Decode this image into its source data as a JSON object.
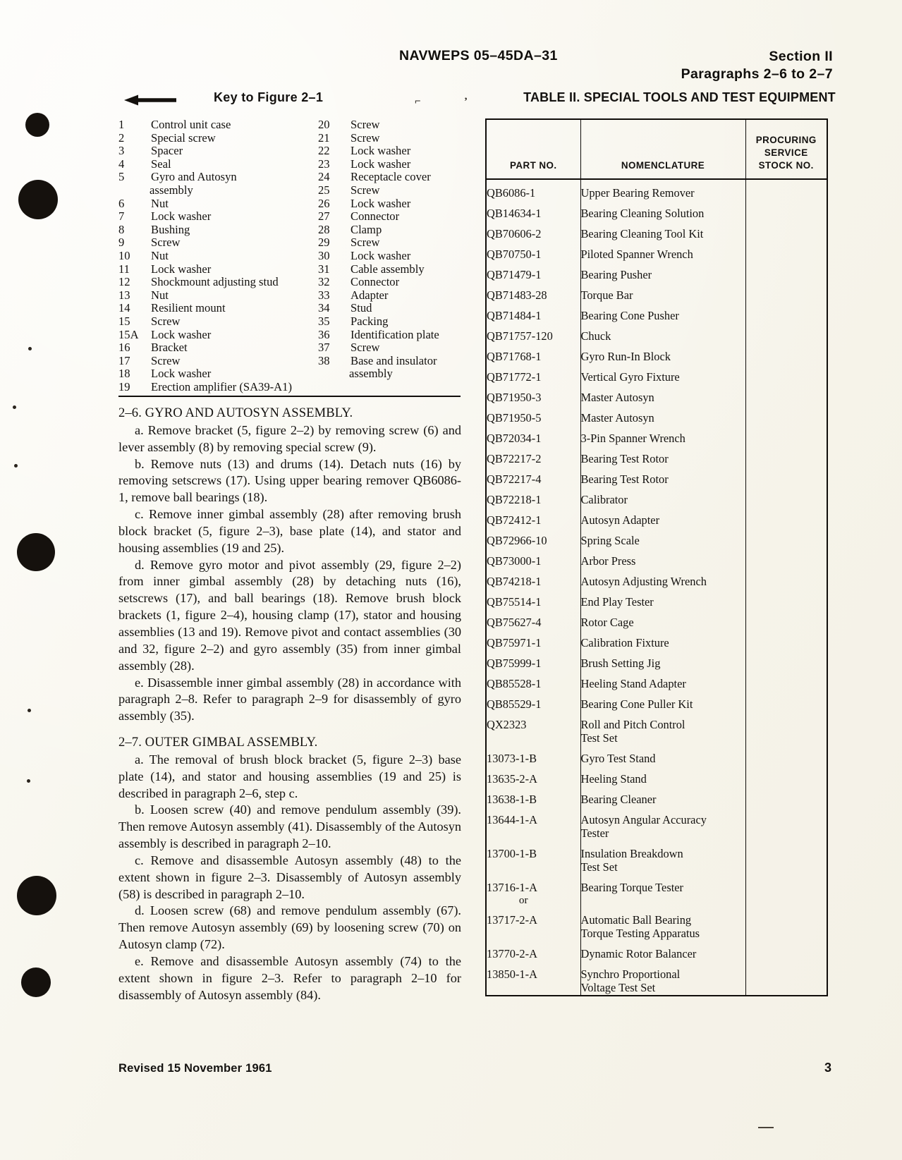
{
  "header": {
    "doc_number": "NAVWEPS 05–45DA–31",
    "section": "Section II",
    "paragraphs": "Paragraphs 2–6 to 2–7"
  },
  "key_figure": {
    "title": "Key to Figure 2–1",
    "back_arrow_icon": "left-arrow-icon",
    "stray_mark_1": "⌐",
    "stray_mark_2": "’",
    "column_1": [
      {
        "num": "1",
        "label": "Control unit case"
      },
      {
        "num": "2",
        "label": "Special screw"
      },
      {
        "num": "3",
        "label": "Spacer"
      },
      {
        "num": "4",
        "label": "Seal"
      },
      {
        "num": "5",
        "label": "Gyro and Autosyn",
        "cont": "assembly"
      },
      {
        "num": "6",
        "label": "Nut"
      },
      {
        "num": "7",
        "label": "Lock washer"
      },
      {
        "num": "8",
        "label": "Bushing"
      },
      {
        "num": "9",
        "label": "Screw"
      },
      {
        "num": "10",
        "label": "Nut"
      },
      {
        "num": "11",
        "label": "Lock washer"
      },
      {
        "num": "12",
        "label": "Shockmount adjusting stud"
      },
      {
        "num": "13",
        "label": "Nut"
      },
      {
        "num": "14",
        "label": "Resilient mount"
      },
      {
        "num": "15",
        "label": "Screw"
      },
      {
        "num": "15A",
        "label": "Lock washer"
      },
      {
        "num": "16",
        "label": "Bracket"
      },
      {
        "num": "17",
        "label": "Screw"
      },
      {
        "num": "18",
        "label": "Lock washer"
      },
      {
        "num": "19",
        "label": "Erection amplifier (SA39-A1)"
      }
    ],
    "column_2": [
      {
        "num": "20",
        "label": "Screw"
      },
      {
        "num": "21",
        "label": "Screw"
      },
      {
        "num": "22",
        "label": "Lock washer"
      },
      {
        "num": "23",
        "label": "Lock washer"
      },
      {
        "num": "24",
        "label": "Receptacle cover"
      },
      {
        "num": "25",
        "label": "Screw"
      },
      {
        "num": "26",
        "label": "Lock washer"
      },
      {
        "num": "27",
        "label": "Connector"
      },
      {
        "num": "28",
        "label": "Clamp"
      },
      {
        "num": "29",
        "label": "Screw"
      },
      {
        "num": "30",
        "label": "Lock washer"
      },
      {
        "num": "31",
        "label": "Cable assembly"
      },
      {
        "num": "32",
        "label": "Connector"
      },
      {
        "num": "33",
        "label": "Adapter"
      },
      {
        "num": "34",
        "label": "Stud"
      },
      {
        "num": "35",
        "label": "Packing"
      },
      {
        "num": "36",
        "label": "Identification plate"
      },
      {
        "num": "37",
        "label": "Screw"
      },
      {
        "num": "38",
        "label": "Base and insulator",
        "cont": "assembly"
      }
    ]
  },
  "body": {
    "section_2_6_heading": "2–6. GYRO AND AUTOSYN ASSEMBLY.",
    "section_2_6_paragraphs": [
      "a. Remove bracket (5, figure 2–2) by removing screw (6) and lever assembly (8) by removing special screw (9).",
      "b. Remove nuts (13) and drums (14). Detach nuts (16) by removing setscrews (17). Using upper bearing remover QB6086-1, remove ball bearings (18).",
      "c. Remove inner gimbal assembly (28) after removing brush block bracket (5, figure 2–3), base plate (14), and stator and housing assemblies (19 and 25).",
      "d. Remove gyro motor and pivot assembly (29, figure 2–2) from inner gimbal assembly (28) by detaching nuts (16), setscrews (17), and ball bearings (18). Remove brush block brackets (1, figure 2–4), housing clamp (17), stator and housing assemblies (13 and 19). Remove pivot and contact assemblies (30 and 32, figure 2–2) and gyro assembly (35) from inner gimbal assembly (28).",
      "e. Disassemble inner gimbal assembly (28) in accordance with paragraph 2–8. Refer to paragraph 2–9 for disassembly of gyro assembly (35)."
    ],
    "section_2_7_heading": "2–7. OUTER GIMBAL ASSEMBLY.",
    "section_2_7_paragraphs": [
      "a. The removal of brush block bracket (5, figure 2–3) base plate (14), and stator and housing assemblies (19 and 25) is described in paragraph 2–6, step c.",
      "b. Loosen screw (40) and remove pendulum assembly (39). Then remove Autosyn assembly (41). Disassembly of the Autosyn assembly is described in paragraph 2–10.",
      "c. Remove and disassemble Autosyn assembly (48) to the extent shown in figure 2–3. Disassembly of Autosyn assembly (58) is described in paragraph 2–10.",
      "d. Loosen screw (68) and remove pendulum assembly (67). Then remove Autosyn assembly (69) by loosening screw (70) on Autosyn clamp (72).",
      "e. Remove and disassemble Autosyn assembly (74) to the extent shown in figure 2–3. Refer to paragraph 2–10 for disassembly of Autosyn assembly (84)."
    ]
  },
  "table": {
    "title": "TABLE II. SPECIAL TOOLS AND TEST EQUIPMENT",
    "columns": [
      "PART NO.",
      "NOMENCLATURE",
      "PROCURING\nSERVICE\nSTOCK NO."
    ],
    "column_headers": {
      "part_no": "PART NO.",
      "nomenclature": "NOMENCLATURE",
      "stock_line_1": "PROCURING",
      "stock_line_2": "SERVICE",
      "stock_line_3": "STOCK NO."
    },
    "rows": [
      {
        "part_no": "QB6086-1",
        "nomenclature": "Upper Bearing Remover",
        "nomenclature_2": "",
        "stock_no": ""
      },
      {
        "part_no": "QB14634-1",
        "nomenclature": "Bearing Cleaning Solution",
        "nomenclature_2": "",
        "stock_no": ""
      },
      {
        "part_no": "QB70606-2",
        "nomenclature": "Bearing Cleaning Tool Kit",
        "nomenclature_2": "",
        "stock_no": ""
      },
      {
        "part_no": "QB70750-1",
        "nomenclature": "Piloted Spanner Wrench",
        "nomenclature_2": "",
        "stock_no": ""
      },
      {
        "part_no": "QB71479-1",
        "nomenclature": "Bearing Pusher",
        "nomenclature_2": "",
        "stock_no": ""
      },
      {
        "part_no": "QB71483-28",
        "nomenclature": "Torque Bar",
        "nomenclature_2": "",
        "stock_no": ""
      },
      {
        "part_no": "QB71484-1",
        "nomenclature": "Bearing Cone Pusher",
        "nomenclature_2": "",
        "stock_no": ""
      },
      {
        "part_no": "QB71757-120",
        "nomenclature": "Chuck",
        "nomenclature_2": "",
        "stock_no": ""
      },
      {
        "part_no": "QB71768-1",
        "nomenclature": "Gyro Run-In Block",
        "nomenclature_2": "",
        "stock_no": ""
      },
      {
        "part_no": "QB71772-1",
        "nomenclature": "Vertical Gyro Fixture",
        "nomenclature_2": "",
        "stock_no": ""
      },
      {
        "part_no": "QB71950-3",
        "nomenclature": "Master Autosyn",
        "nomenclature_2": "",
        "stock_no": ""
      },
      {
        "part_no": "QB71950-5",
        "nomenclature": "Master Autosyn",
        "nomenclature_2": "",
        "stock_no": ""
      },
      {
        "part_no": "QB72034-1",
        "nomenclature": "3-Pin Spanner Wrench",
        "nomenclature_2": "",
        "stock_no": ""
      },
      {
        "part_no": "QB72217-2",
        "nomenclature": "Bearing Test Rotor",
        "nomenclature_2": "",
        "stock_no": ""
      },
      {
        "part_no": "QB72217-4",
        "nomenclature": "Bearing Test Rotor",
        "nomenclature_2": "",
        "stock_no": ""
      },
      {
        "part_no": "QB72218-1",
        "nomenclature": "Calibrator",
        "nomenclature_2": "",
        "stock_no": ""
      },
      {
        "part_no": "QB72412-1",
        "nomenclature": "Autosyn Adapter",
        "nomenclature_2": "",
        "stock_no": ""
      },
      {
        "part_no": "QB72966-10",
        "nomenclature": "Spring Scale",
        "nomenclature_2": "",
        "stock_no": ""
      },
      {
        "part_no": "QB73000-1",
        "nomenclature": "Arbor Press",
        "nomenclature_2": "",
        "stock_no": ""
      },
      {
        "part_no": "QB74218-1",
        "nomenclature": "Autosyn Adjusting Wrench",
        "nomenclature_2": "",
        "stock_no": ""
      },
      {
        "part_no": "QB75514-1",
        "nomenclature": "End Play Tester",
        "nomenclature_2": "",
        "stock_no": ""
      },
      {
        "part_no": "QB75627-4",
        "nomenclature": "Rotor Cage",
        "nomenclature_2": "",
        "stock_no": ""
      },
      {
        "part_no": "QB75971-1",
        "nomenclature": "Calibration Fixture",
        "nomenclature_2": "",
        "stock_no": ""
      },
      {
        "part_no": "QB75999-1",
        "nomenclature": "Brush Setting Jig",
        "nomenclature_2": "",
        "stock_no": ""
      },
      {
        "part_no": "QB85528-1",
        "nomenclature": "Heeling Stand Adapter",
        "nomenclature_2": "",
        "stock_no": ""
      },
      {
        "part_no": "QB85529-1",
        "nomenclature": "Bearing Cone Puller Kit",
        "nomenclature_2": "",
        "stock_no": ""
      },
      {
        "part_no": "QX2323",
        "nomenclature": "Roll and Pitch Control",
        "nomenclature_2": "Test Set",
        "stock_no": ""
      },
      {
        "part_no": "13073-1-B",
        "nomenclature": "Gyro Test Stand",
        "nomenclature_2": "",
        "stock_no": ""
      },
      {
        "part_no": "13635-2-A",
        "nomenclature": "Heeling Stand",
        "nomenclature_2": "",
        "stock_no": ""
      },
      {
        "part_no": "13638-1-B",
        "nomenclature": "Bearing Cleaner",
        "nomenclature_2": "",
        "stock_no": ""
      },
      {
        "part_no": "13644-1-A",
        "nomenclature": "Autosyn Angular Accuracy",
        "nomenclature_2": "Tester",
        "stock_no": ""
      },
      {
        "part_no": "13700-1-B",
        "nomenclature": "Insulation Breakdown",
        "nomenclature_2": "Test Set",
        "stock_no": ""
      },
      {
        "part_no": "13716-1-A",
        "part_no_2": "or",
        "nomenclature": "Bearing Torque Tester",
        "nomenclature_2": "",
        "stock_no": ""
      },
      {
        "part_no": "13717-2-A",
        "nomenclature": "Automatic Ball Bearing",
        "nomenclature_2": "Torque Testing Apparatus",
        "stock_no": ""
      },
      {
        "part_no": "13770-2-A",
        "nomenclature": "Dynamic Rotor Balancer",
        "nomenclature_2": "",
        "stock_no": ""
      },
      {
        "part_no": "13850-1-A",
        "nomenclature": "Synchro Proportional",
        "nomenclature_2": "Voltage Test Set",
        "stock_no": ""
      }
    ]
  },
  "footer": {
    "revision": "Revised 15 November 1961",
    "page_number": "3"
  }
}
